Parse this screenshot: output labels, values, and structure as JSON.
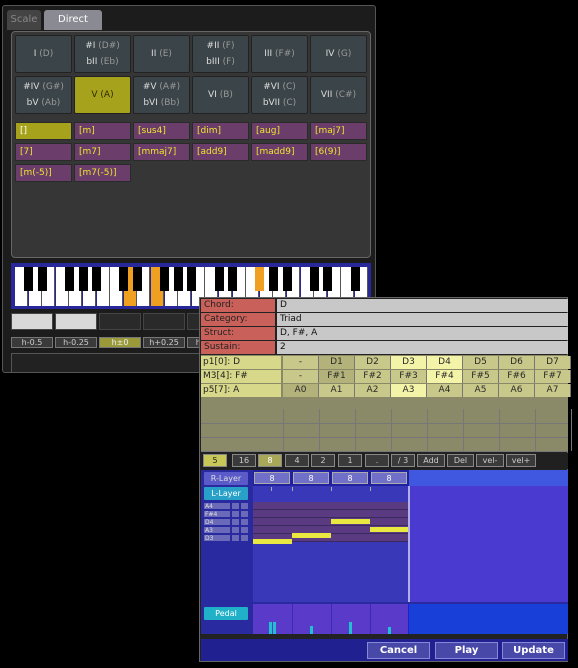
{
  "tabs": [
    {
      "label": "Scale"
    },
    {
      "label": "Direct"
    }
  ],
  "degrees": [
    {
      "top": "I",
      "topsub": "(D)"
    },
    {
      "top": "#I",
      "topsub": "(D#)",
      "bottom": "bII",
      "bottomsub": "(Eb)"
    },
    {
      "top": "II",
      "topsub": "(E)"
    },
    {
      "top": "#II",
      "topsub": "(F)",
      "bottom": "bIII",
      "bottomsub": "(F)"
    },
    {
      "top": "III",
      "topsub": "(F#)"
    },
    {
      "top": "IV",
      "topsub": "(G)"
    },
    {
      "top": "#IV",
      "topsub": "(G#)",
      "bottom": "bV",
      "bottomsub": "(Ab)"
    },
    {
      "top": "V",
      "topsub": "(A)"
    },
    {
      "top": "#V",
      "topsub": "(A#)",
      "bottom": "bVI",
      "bottomsub": "(Bb)"
    },
    {
      "top": "VI",
      "topsub": "(B)"
    },
    {
      "top": "#VI",
      "topsub": "(C)",
      "bottom": "bVII",
      "bottomsub": "(C)"
    },
    {
      "top": "VII",
      "topsub": "(C#)"
    }
  ],
  "chord_types": [
    "[]",
    "[m]",
    "[sus4]",
    "[dim]",
    "[aug]",
    "[maj7]",
    "[7]",
    "[m7]",
    "[mmaj7]",
    "[add9]",
    "[madd9]",
    "[6(9)]",
    "[m(-5)]",
    "[m7(-5)]"
  ],
  "h_buttons": [
    "h-0.5",
    "h-0.25",
    "h±0",
    "h+0.25",
    "h+0.5"
  ],
  "info": {
    "chord_label": "Chord:",
    "chord_value": "D",
    "category_label": "Category:",
    "category_value": "Triad",
    "struct_label": "Struct:",
    "struct_value": "D, F#, A",
    "sustain_label": "Sustain:",
    "sustain_value": "2"
  },
  "tone_rows": [
    {
      "label": "p1[0]: D",
      "cells": [
        "-",
        "D1",
        "D2",
        "D3",
        "D4",
        "D5",
        "D6",
        "D7"
      ]
    },
    {
      "label": "M3[4]: F#",
      "cells": [
        "-",
        "F#1",
        "F#2",
        "F#3",
        "F#4",
        "F#5",
        "F#6",
        "F#7"
      ]
    },
    {
      "label": "p5[7]: A",
      "cells": [
        "A0",
        "A1",
        "A2",
        "A3",
        "A4",
        "A5",
        "A6",
        "A7"
      ]
    }
  ],
  "duration_buttons": [
    "5",
    "16",
    "8",
    "4",
    "2",
    "1",
    ".",
    "/ 3",
    "Add",
    "Del",
    "vel-",
    "vel+"
  ],
  "roll": {
    "r_layer": "R-Layer",
    "l_layer": "L-Layer",
    "pedal": "Pedal",
    "beats": [
      "8",
      "8",
      "8",
      "8"
    ],
    "note_rows": [
      "A4",
      "F#4",
      "D4",
      "A3",
      "D3"
    ]
  },
  "bottom_buttons": {
    "cancel": "Cancel",
    "play": "Play",
    "update": "Update"
  },
  "colors": {
    "accent_yellow": "#a7a21c",
    "chord_type_bg": "#6a3d6a",
    "note_color": "#e8e840",
    "key_pressed": "#f0a020"
  }
}
